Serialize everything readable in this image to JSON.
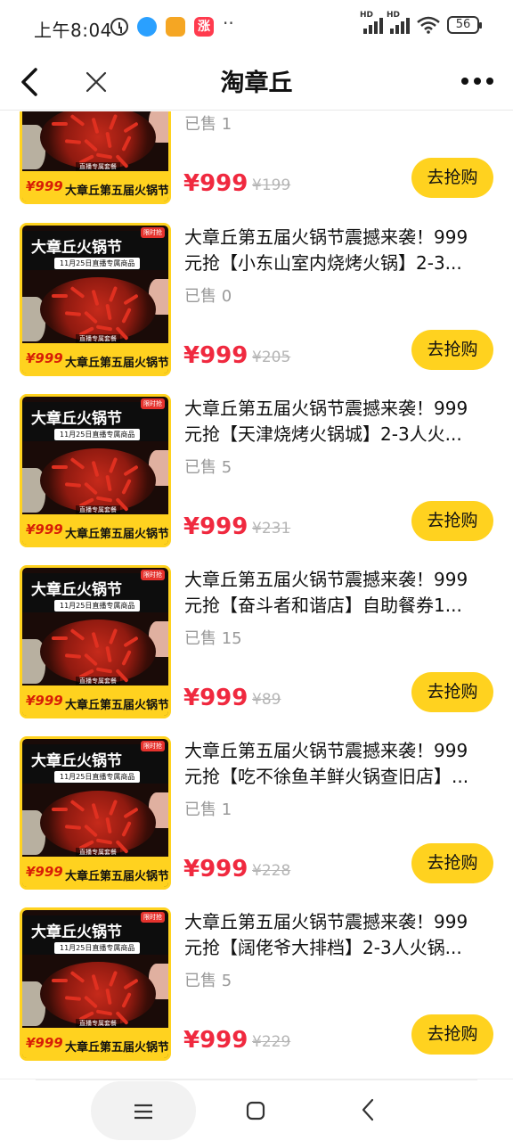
{
  "status_bar": {
    "time": "上午8:04",
    "icons_left": [
      "alarm-icon",
      "qq-browser-icon",
      "message-icon",
      "app-badge-icon",
      "more-dots-icon"
    ],
    "app_badge_text": "涨",
    "signal1_label": "HD",
    "signal2_label": "HD",
    "battery": "56"
  },
  "nav": {
    "title": "淘章丘"
  },
  "items": [
    {
      "title_line1": "",
      "title_line2": "",
      "sold": "已售 1",
      "price": "¥999",
      "original_price": "¥199",
      "button": "去抢购"
    },
    {
      "title_line1": "大章丘第五届火锅节震撼来袭！999",
      "title_line2": "元抢【小东山室内烧烤火锅】2-3...",
      "sold": "已售 0",
      "price": "¥999",
      "original_price": "¥205",
      "button": "去抢购"
    },
    {
      "title_line1": "大章丘第五届火锅节震撼来袭！999",
      "title_line2": "元抢【天津烧烤火锅城】2-3人火...",
      "sold": "已售 5",
      "price": "¥999",
      "original_price": "¥231",
      "button": "去抢购"
    },
    {
      "title_line1": "大章丘第五届火锅节震撼来袭！999",
      "title_line2": "元抢【奋斗者和谐店】自助餐券1...",
      "sold": "已售 15",
      "price": "¥999",
      "original_price": "¥89",
      "button": "去抢购"
    },
    {
      "title_line1": "大章丘第五届火锅节震撼来袭！999",
      "title_line2": "元抢【吃不徐鱼羊鲜火锅查旧店】...",
      "sold": "已售 1",
      "price": "¥999",
      "original_price": "¥228",
      "button": "去抢购"
    },
    {
      "title_line1": "大章丘第五届火锅节震撼来袭！999",
      "title_line2": "元抢【阔佬爷大排档】2-3人火锅...",
      "sold": "已售 5",
      "price": "¥999",
      "original_price": "¥229",
      "button": "去抢购"
    }
  ],
  "thumbnail": {
    "banner_title": "大章丘火锅节",
    "banner_sub": "11月25日直播专属商品",
    "tag": "限时抢",
    "live_label": "直播专属套餐",
    "price": "¥999",
    "bottom_title": "大章丘第五届火锅节"
  },
  "colors": {
    "accent_yellow": "#ffd21f",
    "price_red": "#f0293f",
    "muted_gray": "#9a9a9a"
  }
}
